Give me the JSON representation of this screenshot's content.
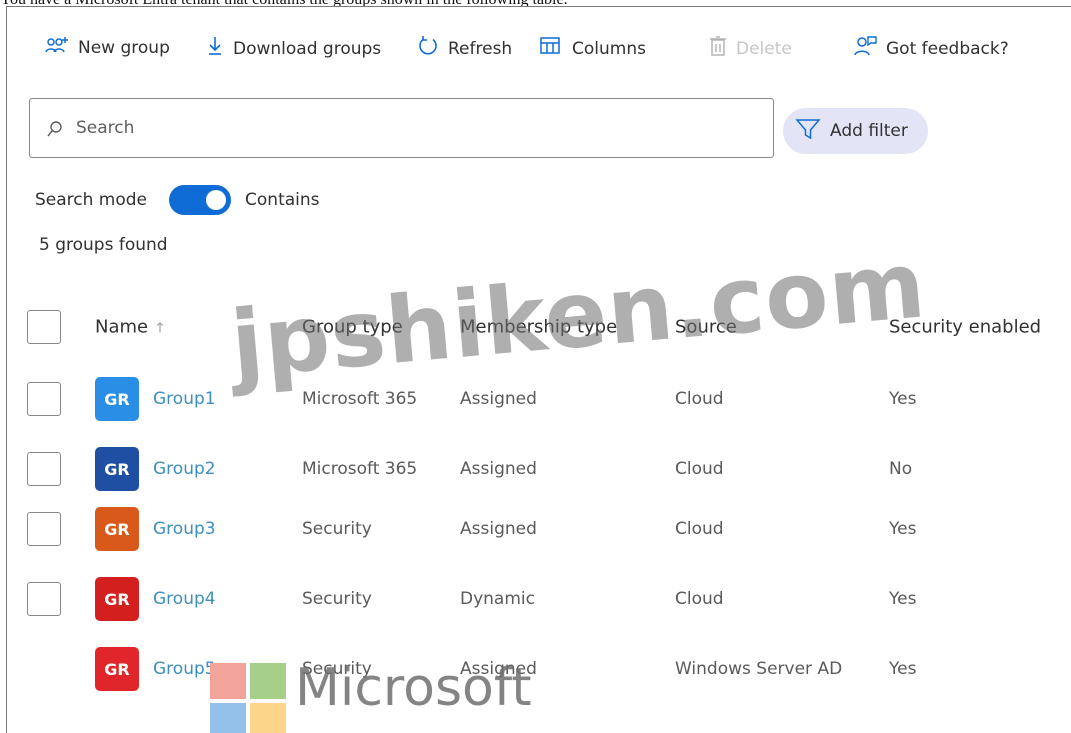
{
  "caption": "You have a Microsoft Entra tenant that contains the groups shown in the following table.",
  "toolbar": {
    "new_group": "New group",
    "download_groups": "Download groups",
    "refresh": "Refresh",
    "columns": "Columns",
    "delete": "Delete",
    "feedback": "Got feedback?"
  },
  "search": {
    "placeholder": "Search"
  },
  "filter": {
    "label": "Add filter"
  },
  "search_mode": {
    "label": "Search mode",
    "value": "Contains",
    "enabled": true
  },
  "results": {
    "count_text": "5 groups found"
  },
  "table": {
    "headers": {
      "name": "Name",
      "group_type": "Group type",
      "membership_type": "Membership type",
      "source": "Source",
      "security_enabled": "Security enabled"
    },
    "rows": [
      {
        "initials": "GR",
        "avatar_color": "#2b8ee6",
        "name": "Group1",
        "group_type": "Microsoft 365",
        "membership_type": "Assigned",
        "source": "Cloud",
        "security_enabled": "Yes"
      },
      {
        "initials": "GR",
        "avatar_color": "#1f4fa3",
        "name": "Group2",
        "group_type": "Microsoft 365",
        "membership_type": "Assigned",
        "source": "Cloud",
        "security_enabled": "No"
      },
      {
        "initials": "GR",
        "avatar_color": "#d9591a",
        "name": "Group3",
        "group_type": "Security",
        "membership_type": "Assigned",
        "source": "Cloud",
        "security_enabled": "Yes"
      },
      {
        "initials": "GR",
        "avatar_color": "#d41f1f",
        "name": "Group4",
        "group_type": "Security",
        "membership_type": "Dynamic",
        "source": "Cloud",
        "security_enabled": "Yes"
      },
      {
        "initials": "GR",
        "avatar_color": "#e0262a",
        "name": "Group5",
        "group_type": "Security",
        "membership_type": "Assigned",
        "source": "Windows Server AD",
        "security_enabled": "Yes"
      }
    ]
  },
  "watermark": {
    "site": "jpshiken.com",
    "brand": "Microsoft"
  },
  "colors": {
    "accent": "#0f6cd6",
    "link": "#3c8fbf",
    "filter_bg": "#e4e4f7"
  }
}
